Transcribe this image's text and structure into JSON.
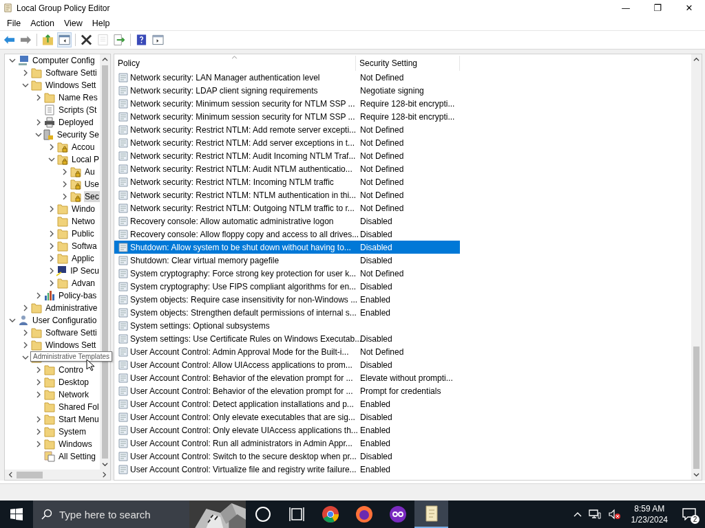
{
  "window": {
    "title": "Local Group Policy Editor",
    "controls": [
      "—",
      "❐",
      "✕"
    ]
  },
  "menu": [
    "File",
    "Action",
    "View",
    "Help"
  ],
  "toolbar": [
    {
      "kind": "back",
      "disabled": false
    },
    {
      "kind": "forward",
      "disabled": false
    },
    {
      "kind": "sep"
    },
    {
      "kind": "up",
      "disabled": false
    },
    {
      "kind": "showhide",
      "disabled": false,
      "selected": true
    },
    {
      "kind": "sep"
    },
    {
      "kind": "delete",
      "disabled": false
    },
    {
      "kind": "properties",
      "disabled": true
    },
    {
      "kind": "export",
      "disabled": false
    },
    {
      "kind": "sep"
    },
    {
      "kind": "help",
      "disabled": false
    },
    {
      "kind": "panel",
      "disabled": false
    }
  ],
  "tree": [
    {
      "label": "Computer Config",
      "kind": "computer",
      "expandable": true,
      "expanded": true,
      "selected": false,
      "children": [
        {
          "label": "Software Setti",
          "kind": "folder",
          "expandable": true,
          "expanded": false,
          "selected": false
        },
        {
          "label": "Windows Sett",
          "kind": "folder",
          "expandable": true,
          "expanded": true,
          "selected": false,
          "children": [
            {
              "label": "Name Res",
              "kind": "folder",
              "expandable": true,
              "expanded": false,
              "selected": false
            },
            {
              "label": "Scripts (St",
              "kind": "script",
              "expandable": false,
              "selected": false
            },
            {
              "label": "Deployed",
              "kind": "printer",
              "expandable": true,
              "expanded": false,
              "selected": false
            },
            {
              "label": "Security Se",
              "kind": "security",
              "expandable": true,
              "expanded": true,
              "selected": false,
              "children": [
                {
                  "label": "Accou",
                  "kind": "lockfolder",
                  "expandable": true,
                  "expanded": false,
                  "selected": false
                },
                {
                  "label": "Local P",
                  "kind": "lockfolder",
                  "expandable": true,
                  "expanded": true,
                  "selected": false,
                  "children": [
                    {
                      "label": "Au",
                      "kind": "lockfolder",
                      "expandable": true,
                      "expanded": false,
                      "selected": false
                    },
                    {
                      "label": "Use",
                      "kind": "lockfolder",
                      "expandable": true,
                      "expanded": false,
                      "selected": false
                    },
                    {
                      "label": "Sec",
                      "kind": "lockfolder",
                      "expandable": true,
                      "expanded": false,
                      "selected": true
                    }
                  ]
                },
                {
                  "label": "Windo",
                  "kind": "folder",
                  "expandable": true,
                  "expanded": false,
                  "selected": false
                },
                {
                  "label": "Netwo",
                  "kind": "folder",
                  "expandable": false,
                  "selected": false
                },
                {
                  "label": "Public",
                  "kind": "folder",
                  "expandable": true,
                  "expanded": false,
                  "selected": false
                },
                {
                  "label": "Softwa",
                  "kind": "folder",
                  "expandable": true,
                  "expanded": false,
                  "selected": false
                },
                {
                  "label": "Applic",
                  "kind": "folder",
                  "expandable": true,
                  "expanded": false,
                  "selected": false
                },
                {
                  "label": "IP Secu",
                  "kind": "ipsec",
                  "expandable": true,
                  "expanded": false,
                  "selected": false
                },
                {
                  "label": "Advan",
                  "kind": "folder",
                  "expandable": true,
                  "expanded": false,
                  "selected": false
                }
              ]
            },
            {
              "label": "Policy-bas",
              "kind": "chart",
              "expandable": true,
              "expanded": false,
              "selected": false
            }
          ]
        },
        {
          "label": "Administrative",
          "kind": "folder",
          "expandable": true,
          "expanded": false,
          "selected": false
        }
      ]
    },
    {
      "label": "User Configuratio",
      "kind": "user",
      "expandable": true,
      "expanded": true,
      "selected": false,
      "children": [
        {
          "label": "Software Setti",
          "kind": "folder",
          "expandable": true,
          "expanded": false,
          "selected": false
        },
        {
          "label": "Windows Sett",
          "kind": "folder",
          "expandable": true,
          "expanded": false,
          "selected": false
        },
        {
          "kind": "folder",
          "expandable": true,
          "expanded": true,
          "children": [
            {
              "label": "Contro",
              "kind": "folder",
              "expandable": true,
              "expanded": false,
              "selected": false
            },
            {
              "label": "Desktop",
              "kind": "folder",
              "expandable": true,
              "expanded": false,
              "selected": false
            },
            {
              "label": "Network",
              "kind": "folder",
              "expandable": true,
              "expanded": false,
              "selected": false
            },
            {
              "label": "Shared Fol",
              "kind": "folder",
              "expandable": false,
              "selected": false
            },
            {
              "label": "Start Menu",
              "kind": "folder",
              "expandable": true,
              "expanded": false,
              "selected": false
            },
            {
              "label": "System",
              "kind": "folder",
              "expandable": true,
              "expanded": false,
              "selected": false
            },
            {
              "label": "Windows",
              "kind": "folder",
              "expandable": true,
              "expanded": false,
              "selected": false
            },
            {
              "label": "All Setting",
              "kind": "allsettings",
              "expandable": false,
              "selected": false
            }
          ]
        }
      ]
    }
  ],
  "tooltip": "Administrative Templates",
  "table": {
    "columns": [
      "Policy",
      "Security Setting"
    ],
    "rows": [
      {
        "policy": "Network security: LAN Manager authentication level",
        "setting": "Not Defined",
        "selected": false
      },
      {
        "policy": "Network security: LDAP client signing requirements",
        "setting": "Negotiate signing",
        "selected": false
      },
      {
        "policy": "Network security: Minimum session security for NTLM SSP ...",
        "setting": "Require 128-bit encrypti...",
        "selected": false
      },
      {
        "policy": "Network security: Minimum session security for NTLM SSP ...",
        "setting": "Require 128-bit encrypti...",
        "selected": false
      },
      {
        "policy": "Network security: Restrict NTLM: Add remote server excepti...",
        "setting": "Not Defined",
        "selected": false
      },
      {
        "policy": "Network security: Restrict NTLM: Add server exceptions in t...",
        "setting": "Not Defined",
        "selected": false
      },
      {
        "policy": "Network security: Restrict NTLM: Audit Incoming NTLM Traf...",
        "setting": "Not Defined",
        "selected": false
      },
      {
        "policy": "Network security: Restrict NTLM: Audit NTLM authenticatio...",
        "setting": "Not Defined",
        "selected": false
      },
      {
        "policy": "Network security: Restrict NTLM: Incoming NTLM traffic",
        "setting": "Not Defined",
        "selected": false
      },
      {
        "policy": "Network security: Restrict NTLM: NTLM authentication in thi...",
        "setting": "Not Defined",
        "selected": false
      },
      {
        "policy": "Network security: Restrict NTLM: Outgoing NTLM traffic to r...",
        "setting": "Not Defined",
        "selected": false
      },
      {
        "policy": "Recovery console: Allow automatic administrative logon",
        "setting": "Disabled",
        "selected": false
      },
      {
        "policy": "Recovery console: Allow floppy copy and access to all drives...",
        "setting": "Disabled",
        "selected": false
      },
      {
        "policy": "Shutdown: Allow system to be shut down without having to...",
        "setting": "Disabled",
        "selected": true
      },
      {
        "policy": "Shutdown: Clear virtual memory pagefile",
        "setting": "Disabled",
        "selected": false
      },
      {
        "policy": "System cryptography: Force strong key protection for user k...",
        "setting": "Not Defined",
        "selected": false
      },
      {
        "policy": "System cryptography: Use FIPS compliant algorithms for en...",
        "setting": "Disabled",
        "selected": false
      },
      {
        "policy": "System objects: Require case insensitivity for non-Windows ...",
        "setting": "Enabled",
        "selected": false
      },
      {
        "policy": "System objects: Strengthen default permissions of internal s...",
        "setting": "Enabled",
        "selected": false
      },
      {
        "policy": "System settings: Optional subsystems",
        "selected": false
      },
      {
        "policy": "System settings: Use Certificate Rules on Windows Executab...",
        "setting": "Disabled",
        "selected": false
      },
      {
        "policy": "User Account Control: Admin Approval Mode for the Built-i...",
        "setting": "Not Defined",
        "selected": false
      },
      {
        "policy": "User Account Control: Allow UIAccess applications to prom...",
        "setting": "Disabled",
        "selected": false
      },
      {
        "policy": "User Account Control: Behavior of the elevation prompt for ...",
        "setting": "Elevate without prompti...",
        "selected": false
      },
      {
        "policy": "User Account Control: Behavior of the elevation prompt for ...",
        "setting": "Prompt for credentials",
        "selected": false
      },
      {
        "policy": "User Account Control: Detect application installations and p...",
        "setting": "Enabled",
        "selected": false
      },
      {
        "policy": "User Account Control: Only elevate executables that are sig...",
        "setting": "Disabled",
        "selected": false
      },
      {
        "policy": "User Account Control: Only elevate UIAccess applications th...",
        "setting": "Enabled",
        "selected": false
      },
      {
        "policy": "User Account Control: Run all administrators in Admin Appr...",
        "setting": "Enabled",
        "selected": false
      },
      {
        "policy": "User Account Control: Switch to the secure desktop when pr...",
        "setting": "Disabled",
        "selected": false
      },
      {
        "policy": "User Account Control: Virtualize file and registry write failure...",
        "setting": "Enabled",
        "selected": false
      }
    ]
  },
  "taskbar": {
    "search": {
      "placeholder": "Type here to search"
    },
    "apps": [
      {
        "kind": "cortana",
        "active": false
      },
      {
        "kind": "taskview",
        "active": false
      },
      {
        "kind": "chrome",
        "active": false
      },
      {
        "kind": "firefox",
        "active": false
      },
      {
        "kind": "infinity",
        "active": false
      },
      {
        "kind": "gpedit",
        "active": true
      }
    ],
    "time": "8:59 AM",
    "date": "1/23/2024",
    "notifications": "2"
  }
}
